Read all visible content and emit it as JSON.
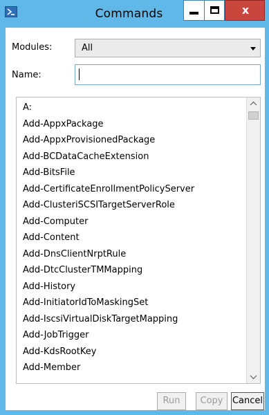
{
  "window": {
    "title": "Commands",
    "close_symbol": "x",
    "app_icon": "powershell-icon"
  },
  "form": {
    "modules_label": "Modules:",
    "modules_value": "All",
    "name_label": "Name:",
    "name_value": ""
  },
  "commands": [
    "A:",
    "Add-AppxPackage",
    "Add-AppxProvisionedPackage",
    "Add-BCDataCacheExtension",
    "Add-BitsFile",
    "Add-CertificateEnrollmentPolicyServer",
    "Add-ClusteriSCSITargetServerRole",
    "Add-Computer",
    "Add-Content",
    "Add-DnsClientNrptRule",
    "Add-DtcClusterTMMapping",
    "Add-History",
    "Add-InitiatorIdToMaskingSet",
    "Add-IscsiVirtualDiskTargetMapping",
    "Add-JobTrigger",
    "Add-KdsRootKey",
    "Add-Member"
  ],
  "buttons": {
    "run": "Run",
    "copy": "Copy",
    "cancel": "Cancel"
  },
  "colors": {
    "frame": "#5fb8e8",
    "close_button": "#c9463d"
  }
}
